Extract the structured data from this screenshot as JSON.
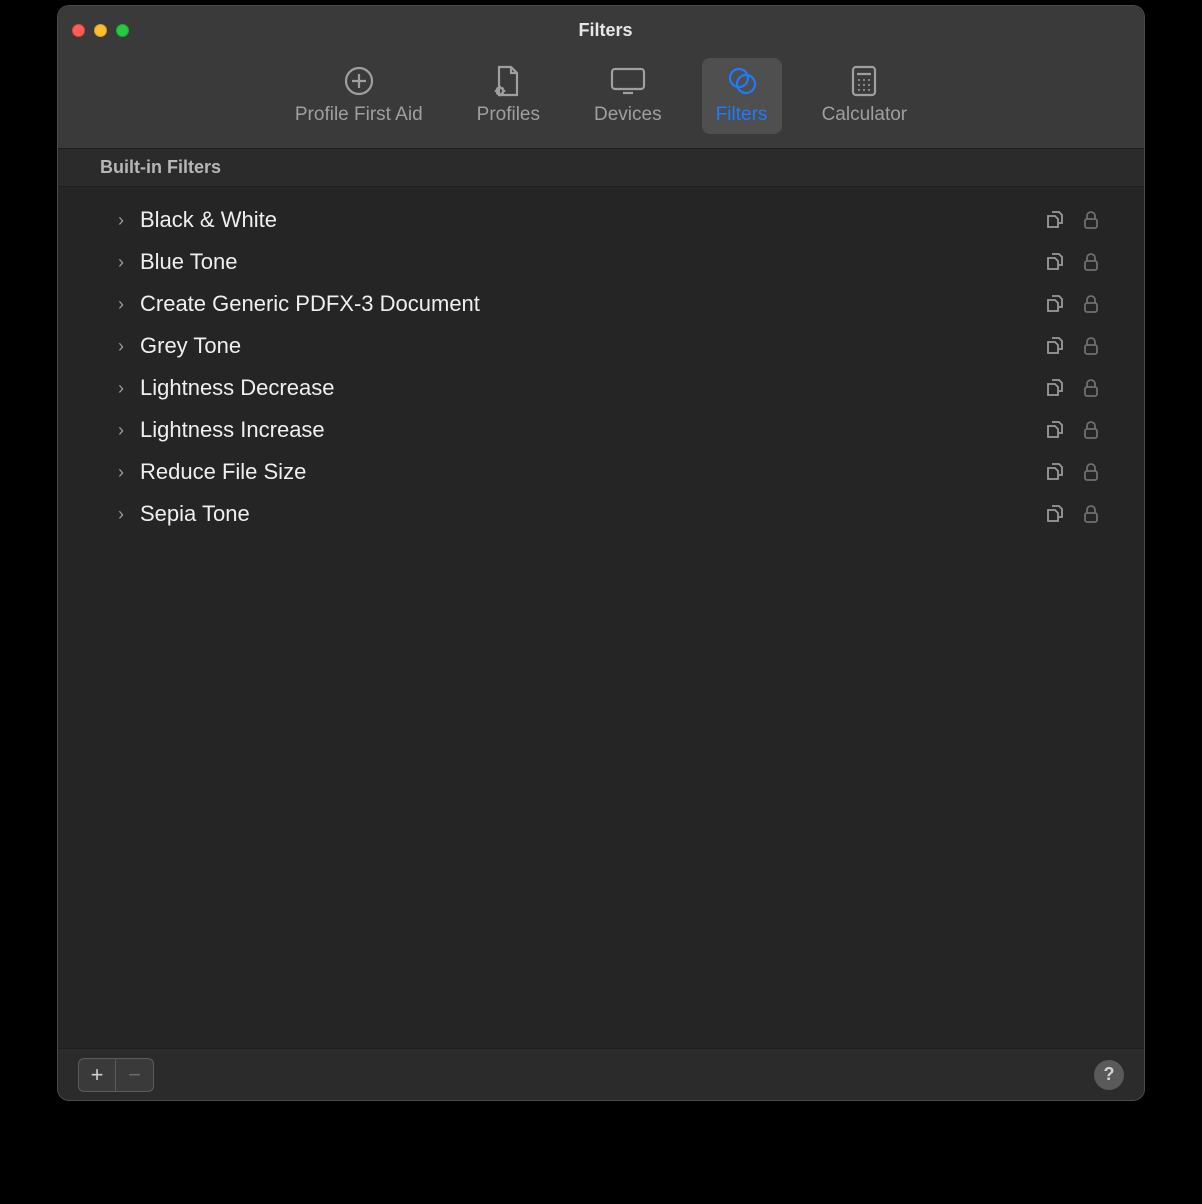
{
  "window": {
    "title": "Filters"
  },
  "toolbar": {
    "tabs": [
      {
        "label": "Profile First Aid",
        "icon": "first-aid-icon",
        "active": false
      },
      {
        "label": "Profiles",
        "icon": "profile-doc-icon",
        "active": false
      },
      {
        "label": "Devices",
        "icon": "display-icon",
        "active": false
      },
      {
        "label": "Filters",
        "icon": "filters-icon",
        "active": true
      },
      {
        "label": "Calculator",
        "icon": "calculator-icon",
        "active": false
      }
    ]
  },
  "section": {
    "heading": "Built-in Filters"
  },
  "filters": [
    {
      "name": "Black & White"
    },
    {
      "name": "Blue Tone"
    },
    {
      "name": "Create Generic PDFX-3 Document"
    },
    {
      "name": "Grey Tone"
    },
    {
      "name": "Lightness Decrease"
    },
    {
      "name": "Lightness Increase"
    },
    {
      "name": "Reduce File Size"
    },
    {
      "name": "Sepia Tone"
    }
  ],
  "footer": {
    "add_label": "+",
    "remove_label": "−",
    "help_label": "?"
  }
}
